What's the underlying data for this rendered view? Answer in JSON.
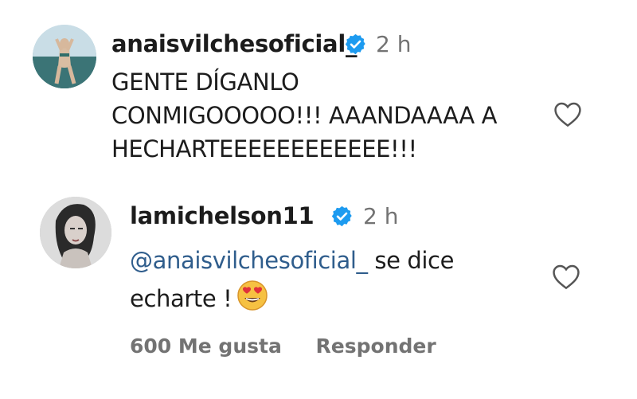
{
  "comments": [
    {
      "username": "anaisvilchesoficial_",
      "verified": true,
      "time": "2 h",
      "lines": [
        "GENTE DÍGANLO",
        "CONMIGOOOOO!!! AAANDAAAA A",
        "HECHARTEEEEEEEEEEEE!!!"
      ],
      "like_icon": "heart-outline-icon"
    },
    {
      "username": "lamichelson11",
      "verified": true,
      "time": "2 h",
      "mention": "@anaisvilchesoficial_",
      "line1_rest": " se dice",
      "line2": "echarte !",
      "emoji": "heart-eyes-emoji",
      "like_icon": "heart-outline-icon",
      "likes_label": "600 Me gusta",
      "reply_label": "Responder"
    }
  ],
  "colors": {
    "verified": "#1d9bf0",
    "mention": "#2f5d8c",
    "secondary_text": "#737373"
  }
}
